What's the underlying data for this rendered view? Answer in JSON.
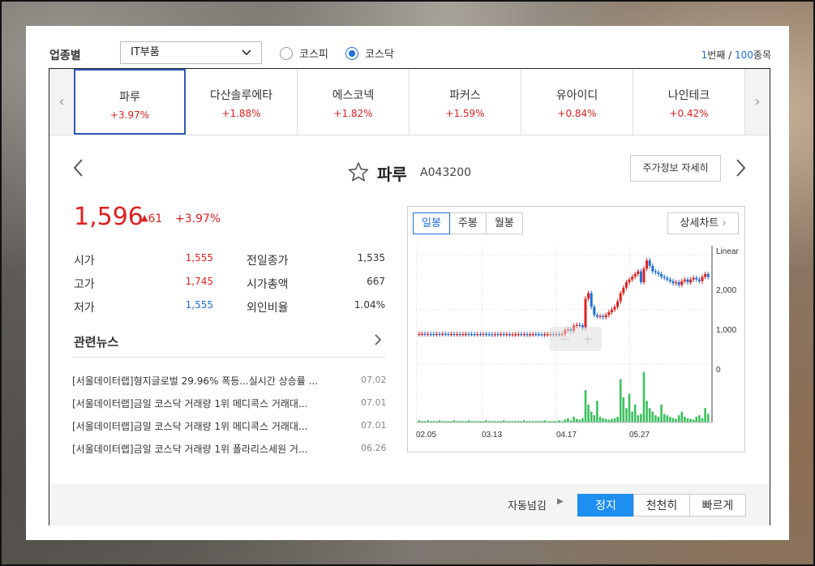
{
  "filter": {
    "industry_label": "업종별",
    "industry_value": "IT부품",
    "markets": [
      {
        "label": "코스피",
        "selected": false
      },
      {
        "label": "코스닥",
        "selected": true
      }
    ],
    "counter_current": "1",
    "counter_current_suffix": "번째 / ",
    "counter_total": "100",
    "counter_total_suffix": "종목"
  },
  "tabs": [
    {
      "name": "파루",
      "rate": "+3.97%"
    },
    {
      "name": "다산솔루에타",
      "rate": "+1.88%"
    },
    {
      "name": "에스코넥",
      "rate": "+1.82%"
    },
    {
      "name": "파커스",
      "rate": "+1.59%"
    },
    {
      "name": "유아이디",
      "rate": "+0.84%"
    },
    {
      "name": "나인테크",
      "rate": "+0.42%"
    }
  ],
  "stock": {
    "name": "파루",
    "code": "A043200",
    "detail_button": "주가정보 자세히",
    "price": "1,596",
    "change": "61",
    "change_pct": "+3.97%",
    "stats_left": [
      {
        "label": "시가",
        "value": "1,555",
        "color": "#e02020"
      },
      {
        "label": "고가",
        "value": "1,745",
        "color": "#e02020"
      },
      {
        "label": "저가",
        "value": "1,555",
        "color": "#1e6fd9"
      }
    ],
    "stats_right": [
      {
        "label": "전일종가",
        "value": "1,535"
      },
      {
        "label": "시가총액",
        "value": "667"
      },
      {
        "label": "외인비율",
        "value": "1.04%"
      }
    ]
  },
  "news": {
    "heading": "관련뉴스",
    "items": [
      {
        "title": "[서울데이터랩]형지글로벌 29.96% 폭등...실시간 상승률 ...",
        "date": "07.02"
      },
      {
        "title": "[서울데이터랩]금일 코스닥 거래량 1위 메디콕스 거래대...",
        "date": "07.01"
      },
      {
        "title": "[서울데이터랩]금일 코스닥 거래량 1위 메디콕스 거래대...",
        "date": "07.01"
      },
      {
        "title": "[서울데이터랩]금일 코스닥 거래량 1위 폴라리스세원 거...",
        "date": "06.26"
      }
    ]
  },
  "chart": {
    "period_tabs": [
      "일봉",
      "주봉",
      "월봉"
    ],
    "selected_period": "일봉",
    "detail_button": "상세차트",
    "scale_label": "Linear",
    "y_ticks": [
      "2,000",
      "1,000",
      "0"
    ],
    "x_ticks": [
      "02.05",
      "03.13",
      "04.17",
      "05.27"
    ],
    "colors": {
      "up": "#e02020",
      "down": "#1e6fd9",
      "volume": "#3cc060"
    }
  },
  "chart_data": {
    "type": "candlestick",
    "x_ticks": [
      "02.05",
      "03.13",
      "04.17",
      "05.27"
    ],
    "ylim": [
      0,
      2300
    ],
    "close": [
      550,
      555,
      548,
      552,
      550,
      545,
      552,
      548,
      555,
      550,
      548,
      552,
      547,
      550,
      545,
      548,
      552,
      550,
      548,
      545,
      550,
      548,
      552,
      548,
      545,
      540,
      548,
      545,
      550,
      545,
      548,
      543,
      545,
      548,
      550,
      545,
      548,
      540,
      545,
      550,
      548,
      545,
      540,
      545,
      548,
      550,
      545,
      548,
      545,
      550,
      620,
      640,
      610,
      700,
      720,
      710,
      660,
      1200,
      1300,
      1050,
      900,
      870,
      880,
      860,
      900,
      950,
      1000,
      1050,
      1150,
      1300,
      1400,
      1500,
      1550,
      1600,
      1650,
      1700,
      1500,
      1750,
      1900,
      1800,
      1700,
      1680,
      1650,
      1600,
      1580,
      1550,
      1520,
      1480,
      1500,
      1450,
      1520,
      1550,
      1500,
      1550,
      1580,
      1550,
      1520,
      1600,
      1650,
      1596
    ],
    "volume_relative": [
      3,
      2,
      2,
      3,
      2,
      2,
      2,
      3,
      2,
      2,
      2,
      2,
      3,
      2,
      2,
      2,
      2,
      3,
      2,
      2,
      2,
      2,
      2,
      3,
      2,
      2,
      2,
      2,
      2,
      3,
      2,
      2,
      2,
      2,
      2,
      2,
      3,
      2,
      2,
      2,
      2,
      2,
      2,
      3,
      2,
      2,
      2,
      2,
      3,
      2,
      4,
      6,
      3,
      8,
      5,
      4,
      6,
      45,
      25,
      15,
      10,
      30,
      8,
      6,
      5,
      4,
      5,
      6,
      8,
      60,
      35,
      20,
      40,
      15,
      25,
      10,
      12,
      70,
      30,
      20,
      15,
      10,
      8,
      25,
      12,
      10,
      8,
      6,
      5,
      10,
      15,
      8,
      6,
      5,
      4,
      8,
      10,
      6,
      20,
      12
    ]
  },
  "footer": {
    "auto_label": "자동넘김",
    "buttons": [
      {
        "label": "정지",
        "active": true
      },
      {
        "label": "천천히",
        "active": false
      },
      {
        "label": "빠르게",
        "active": false
      }
    ]
  }
}
